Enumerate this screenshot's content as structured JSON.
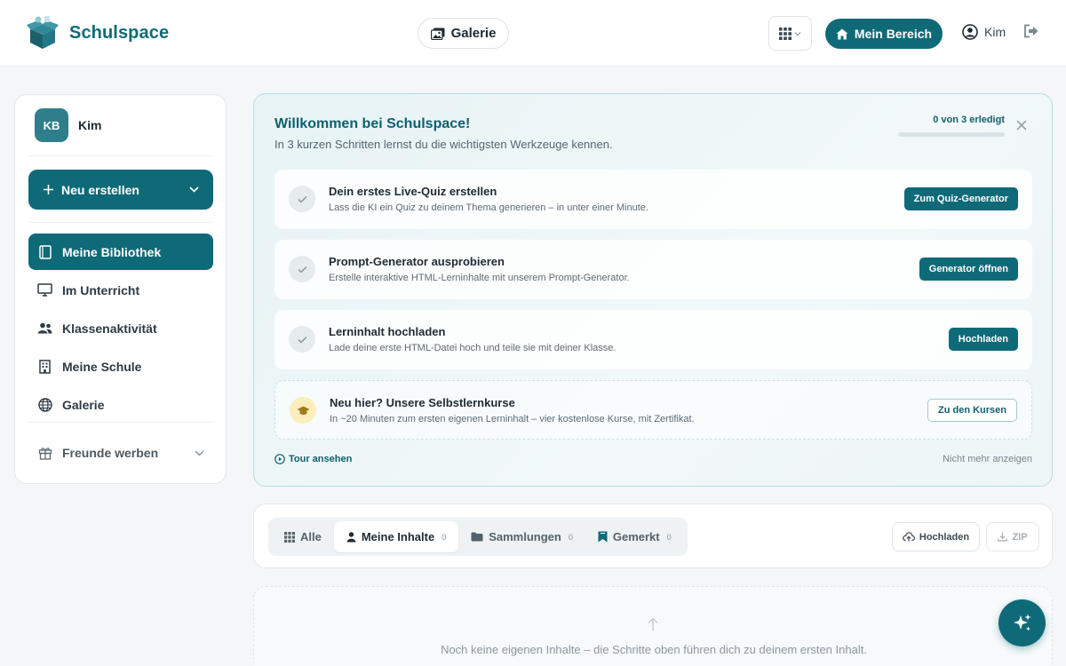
{
  "header": {
    "brand": "Schulspace",
    "galerie_label": "Galerie",
    "mein_bereich_label": "Mein Bereich",
    "user_name": "Kim"
  },
  "sidebar": {
    "avatar_initials": "KB",
    "user_name": "Kim",
    "new_button_label": "Neu erstellen",
    "items": [
      {
        "label": "Meine Bibliothek",
        "icon": "book-icon",
        "active": true
      },
      {
        "label": "Im Unterricht",
        "icon": "monitor-icon",
        "active": false
      },
      {
        "label": "Klassenaktivität",
        "icon": "users-icon",
        "active": false
      },
      {
        "label": "Meine Schule",
        "icon": "building-icon",
        "active": false
      },
      {
        "label": "Galerie",
        "icon": "globe-icon",
        "active": false
      }
    ],
    "referral_label": "Freunde werben"
  },
  "welcome": {
    "title": "Willkommen bei Schulspace!",
    "subtitle": "In 3 kurzen Schritten lernst du die wichtigsten Werkzeuge kennen.",
    "progress_label": "0 von 3 erledigt",
    "progress_fraction": 0,
    "steps": [
      {
        "title": "Dein erstes Live-Quiz erstellen",
        "description": "Lass die KI ein Quiz zu deinem Thema generieren – in unter einer Minute.",
        "button": "Zum Quiz-Generator"
      },
      {
        "title": "Prompt-Generator ausprobieren",
        "description": "Erstelle interaktive HTML-Lerninhalte mit unserem Prompt-Generator.",
        "button": "Generator öffnen"
      },
      {
        "title": "Lerninhalt hochladen",
        "description": "Lade deine erste HTML-Datei hoch und teile sie mit deiner Klasse.",
        "button": "Hochladen"
      }
    ],
    "course": {
      "title": "Neu hier? Unsere Selbstlernkurse",
      "description": "In ~20 Minuten zum ersten eigenen Lerninhalt – vier kostenlose Kurse, mit Zertifikat.",
      "button": "Zu den Kursen"
    },
    "tour_label": "Tour ansehen",
    "dismiss_label": "Nicht mehr anzeigen"
  },
  "library": {
    "tabs": [
      {
        "label": "Alle",
        "count": "",
        "icon": "grid-icon",
        "active": false
      },
      {
        "label": "Meine Inhalte",
        "count": "0",
        "icon": "person-icon",
        "active": true
      },
      {
        "label": "Sammlungen",
        "count": "0",
        "icon": "folder-icon",
        "active": false
      },
      {
        "label": "Gemerkt",
        "count": "0",
        "icon": "bookmark-icon",
        "active": false
      }
    ],
    "upload_label": "Hochladen",
    "zip_label": "ZIP",
    "empty_text": "Noch keine eigenen Inhalte – die Schritte oben führen dich zu deinem ersten Inhalt."
  },
  "colors": {
    "accent": "#0f6a78",
    "background": "#f4f6f8"
  }
}
